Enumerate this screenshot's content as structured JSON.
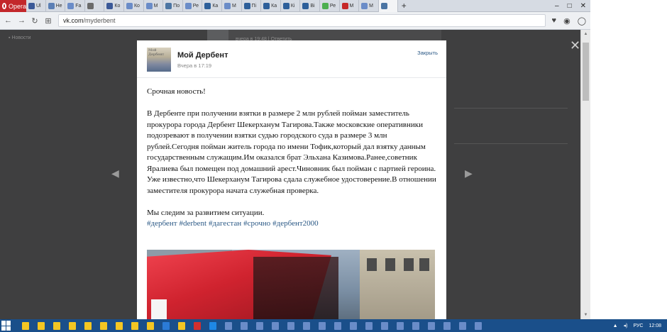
{
  "browser": {
    "menu_label": "Opera",
    "tabs": [
      {
        "label": "Ul",
        "color": "#3b5998"
      },
      {
        "label": "Не",
        "color": "#5b7fb5"
      },
      {
        "label": "Fa",
        "color": "#6a8cc8"
      },
      {
        "label": "",
        "color": "#6b6b6b"
      },
      {
        "label": "Ко",
        "color": "#3b5998"
      },
      {
        "label": "Ко",
        "color": "#6a8cc8"
      },
      {
        "label": "М",
        "color": "#6a8cc8"
      },
      {
        "label": "По",
        "color": "#4c75a3"
      },
      {
        "label": "Ре",
        "color": "#6a8cc8"
      },
      {
        "label": "Ка",
        "color": "#2d5f9a"
      },
      {
        "label": "М",
        "color": "#6a8cc8"
      },
      {
        "label": "Пі",
        "color": "#2d5f9a"
      },
      {
        "label": "Ка",
        "color": "#2d5f9a"
      },
      {
        "label": "Кі",
        "color": "#2d5f9a"
      },
      {
        "label": "Ві",
        "color": "#2d5f9a"
      },
      {
        "label": "Ре",
        "color": "#4caf50"
      },
      {
        "label": "М",
        "color": "#c62828"
      },
      {
        "label": "М",
        "color": "#6a8cc8"
      },
      {
        "label": "",
        "color": "#4c75a3"
      }
    ],
    "address": {
      "host": "vk.com",
      "path": "/myderbent"
    }
  },
  "background": {
    "sidebar_item": "Новости",
    "feed_meta": "вчера в 19:48 | Ответить"
  },
  "post": {
    "author": "Мой Дербент",
    "time": "Вчера в 17:19",
    "close_label": "Закрыть",
    "avatar_text": "Мой\nДербент",
    "headline": "Срочная новость!",
    "paragraph": "В Дербенте при получении взятки в размере 2 млн рублей пойман заместитель прокурора города Дербент Шекерханум Тагирова.Также московские оперативники подозревают в получении взятки судью городского суда в размере 3 млн рублей.Сегодня пойман житель города по имени Тофик,который дал взятку данным государственным служащим.Им оказался брат Эльхана Казимова.Ранее,советник Яралиева был помещен под домашний арест.Чиновник был пойман с партией героина.",
    "paragraph2": "Уже известно,что Шекерханум Тагирова сдала служебное удостоверение.В отношении заместителя прокурора начата служебная проверка.",
    "closing": "Мы следим за развитием ситуации.",
    "hashtags": [
      "#дербент",
      "#derbent",
      "#дагестан",
      "#срочно",
      "#дербент2000"
    ]
  },
  "taskbar": {
    "lang": "РУС",
    "clock": "12:08"
  },
  "colors": {
    "link": "#2a5885",
    "opera_red": "#c3272b",
    "taskbar": "#1a4f8a"
  }
}
